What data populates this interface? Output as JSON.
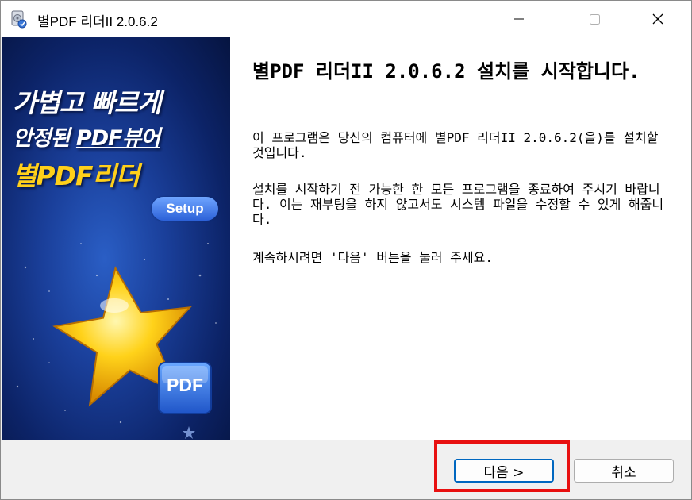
{
  "window": {
    "title": "별PDF 리더II 2.0.6.2",
    "icon": "installer-disk-icon",
    "controls": {
      "minimize": "minimize-icon",
      "maximize": "maximize-icon",
      "close": "close-icon"
    }
  },
  "banner": {
    "line1": "가볍고 빠르게",
    "line2_prefix": "안정된 ",
    "line2_emph": "PDF뷰어",
    "line3": "별PDF리더",
    "setup_badge": "Setup",
    "pdf_badge": "PDF"
  },
  "content": {
    "heading": "별PDF 리더II 2.0.6.2 설치를 시작합니다.",
    "paragraph1": "이 프로그램은 당신의 컴퓨터에 별PDF 리더II 2.0.6.2(을)를 설치할 것입니다.",
    "paragraph2": "설치를 시작하기 전 가능한 한 모든 프로그램을 종료하여 주시기 바랍니다. 이는 재부팅을 하지 않고서도 시스템 파일을 수정할 수 있게 해줍니다.",
    "paragraph3": "계속하시려면 '다음' 버튼을 눌러 주세요."
  },
  "buttons": {
    "next": "다음 >",
    "cancel": "취소"
  },
  "colors": {
    "highlight": "#e81010",
    "banner_blue": "#1a3f9a",
    "banner_yellow": "#ffd01a",
    "focus_blue": "#0067c0"
  }
}
